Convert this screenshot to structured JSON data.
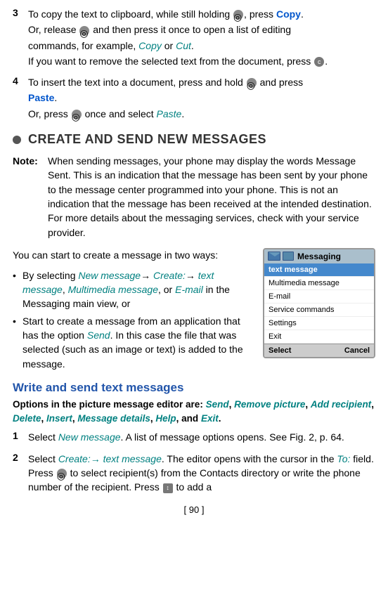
{
  "steps_top": [
    {
      "number": "3",
      "lines": [
        "To copy the text to clipboard, while still holding [nav], press Copy.",
        "Or, release [nav] and then press it once to open a list of editing",
        "commands, for example, Copy or Cut.",
        "If you want to remove the selected text from the document, press [c]."
      ]
    },
    {
      "number": "4",
      "lines": [
        "To insert the text into a document, press and hold [nav] and press",
        "Paste.",
        "Or, press [nav] once and select Paste."
      ]
    }
  ],
  "section": {
    "title": "CREATE AND SEND NEW MESSAGES"
  },
  "note": {
    "label": "Note:",
    "text": "When sending messages, your phone may display the words Message Sent. This is an indication that the message has been sent by your phone to the message center programmed into your phone. This is not an indication that the message has been received at the intended destination. For more details about the messaging services, check with your service provider."
  },
  "intro_text": "You can start to create a message in two ways:",
  "bullets": [
    "By selecting New message→ Create:→ text message, Multimedia message, or E-mail in the Messaging main view, or",
    "Start to create a message from an application that has the option Send. In this case the file that was selected (such as an image or text) is added to the message."
  ],
  "phone_ui": {
    "title": "Messaging",
    "menu_items": [
      {
        "label": "text message",
        "selected": true
      },
      {
        "label": "Multimedia message",
        "selected": false
      },
      {
        "label": "E-mail",
        "selected": false
      },
      {
        "label": "Service commands",
        "selected": false
      },
      {
        "label": "Settings",
        "selected": false
      },
      {
        "label": "Exit",
        "selected": false
      }
    ],
    "footer_left": "Select",
    "footer_right": "Cancel"
  },
  "subsection": {
    "title": "Write and send text messages"
  },
  "options_line": {
    "label": "Options in the picture message editor are:",
    "items": "Send, Remove picture, Add recipient, Delete, Insert, Message details, Help, and Exit."
  },
  "steps_bottom": [
    {
      "number": "1",
      "text": "Select New message. A list of message options opens. See Fig. 2, p. 64."
    },
    {
      "number": "2",
      "text": "Select Create:→ text message. The editor opens with the cursor in the To: field. Press [nav] to select recipient(s) from the Contacts directory or write the phone number of the recipient. Press [arrow] to add a"
    }
  ],
  "page_number": "[ 90 ]"
}
